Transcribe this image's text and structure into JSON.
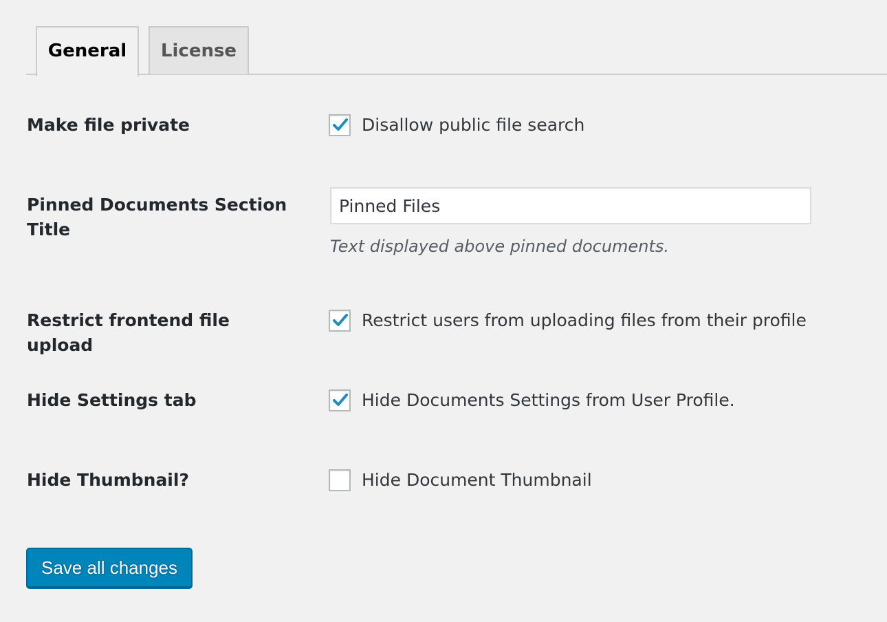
{
  "tabs": [
    {
      "label": "General",
      "active": true
    },
    {
      "label": "License",
      "active": false
    }
  ],
  "settings": {
    "make_private": {
      "label": "Make file private",
      "checkbox_label": "Disallow public file search",
      "checked": true
    },
    "pinned_title": {
      "label": "Pinned Documents Section Title",
      "value": "Pinned Files",
      "description": "Text displayed above pinned documents."
    },
    "restrict_upload": {
      "label": "Restrict frontend file upload",
      "checkbox_label": "Restrict users from uploading files from their profile",
      "checked": true
    },
    "hide_settings": {
      "label": "Hide Settings tab",
      "checkbox_label": "Hide Documents Settings from User Profile.",
      "checked": true
    },
    "hide_thumbnail": {
      "label": "Hide Thumbnail?",
      "checkbox_label": "Hide Document Thumbnail",
      "checked": false
    }
  },
  "save_button": {
    "label": "Save all changes"
  },
  "colors": {
    "accent": "#1e8cbe",
    "button": "#0085ba",
    "background": "#f1f1f1"
  },
  "icons": {
    "checkmark": "checkmark-icon"
  }
}
